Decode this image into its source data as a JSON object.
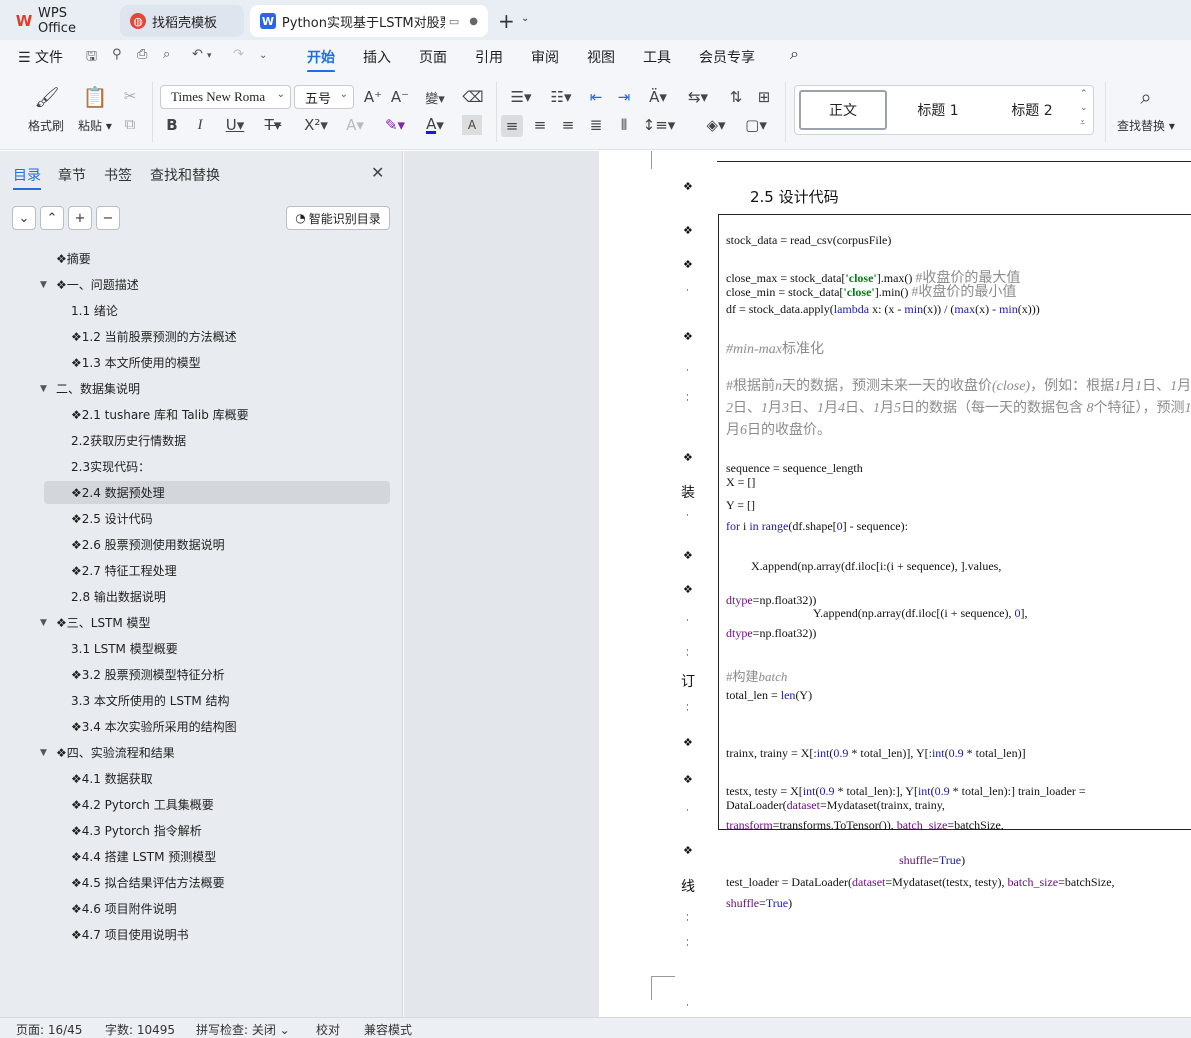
{
  "tabs": [
    {
      "label": "WPS Office",
      "icon": "wps-logo-icon",
      "color": "#e23b2e"
    },
    {
      "label": "找稻壳模板",
      "icon": "docer-icon",
      "color": "#e2473b"
    },
    {
      "label": "Python实现基于LSTM对股票走",
      "icon": "word-doc-icon",
      "color": "#2a66e3"
    }
  ],
  "menu": {
    "file": "文件",
    "items": [
      "开始",
      "插入",
      "页面",
      "引用",
      "审阅",
      "视图",
      "工具",
      "会员专享"
    ],
    "active": "开始"
  },
  "ribbon": {
    "format_painter": "格式刷",
    "paste": "粘贴",
    "font_name": "Times New Roma",
    "font_size": "五号",
    "styles": [
      "正文",
      "标题  1",
      "标题  2"
    ],
    "find_replace": "查找替换"
  },
  "nav": {
    "tabs": [
      "目录",
      "章节",
      "书签",
      "查找和替换"
    ],
    "smart_toc": "智能识别目录",
    "items": [
      {
        "text": "❖摘要",
        "level": 0
      },
      {
        "text": "❖一、问题描述",
        "level": 0,
        "expander": true
      },
      {
        "text": "1.1 绪论",
        "level": 1
      },
      {
        "text": "❖1.2 当前股票预测的方法概述",
        "level": 1
      },
      {
        "text": "❖1.3 本文所使用的模型",
        "level": 1
      },
      {
        "text": "二、数据集说明",
        "level": 0,
        "expander": true
      },
      {
        "text": "❖2.1 tushare 库和 Talib 库概要",
        "level": 1
      },
      {
        "text": "2.2获取历史行情数据",
        "level": 1
      },
      {
        "text": "2.3实现代码：",
        "level": 1
      },
      {
        "text": "❖2.4 数据预处理",
        "level": 1,
        "selected": true
      },
      {
        "text": "❖2.5 设计代码",
        "level": 1
      },
      {
        "text": "❖2.6 股票预测使用数据说明",
        "level": 1
      },
      {
        "text": "❖2.7 特征工程处理",
        "level": 1
      },
      {
        "text": "2.8 输出数据说明",
        "level": 1
      },
      {
        "text": "❖三、LSTM 模型",
        "level": 0,
        "expander": true
      },
      {
        "text": "3.1 LSTM 模型概要",
        "level": 1
      },
      {
        "text": "❖3.2 股票预测模型特征分析",
        "level": 1
      },
      {
        "text": "3.3 本文所使用的 LSTM 结构",
        "level": 1
      },
      {
        "text": "❖3.4 本次实验所采用的结构图",
        "level": 1
      },
      {
        "text": "❖四、实验流程和结果",
        "level": 0,
        "expander": true
      },
      {
        "text": "❖4.1 数据获取",
        "level": 1
      },
      {
        "text": "❖4.2 Pytorch 工具集概要",
        "level": 1
      },
      {
        "text": "❖4.3 Pytorch 指令解析",
        "level": 1
      },
      {
        "text": "❖4.4 搭建 LSTM 预测模型",
        "level": 1
      },
      {
        "text": "❖4.5 拟合结果评估方法概要",
        "level": 1
      },
      {
        "text": "❖4.6 项目附件说明",
        "level": 1
      },
      {
        "text": "❖4.7 项目使用说明书",
        "level": 1
      }
    ]
  },
  "doc": {
    "heading": "2.5  设计代码",
    "margin_chars": [
      "装",
      "订",
      "线"
    ]
  },
  "status": {
    "page": "页面: 16/45",
    "words": "字数: 10495",
    "spell": "拼写检查: 关闭",
    "proof": "校对",
    "compat": "兼容模式"
  }
}
